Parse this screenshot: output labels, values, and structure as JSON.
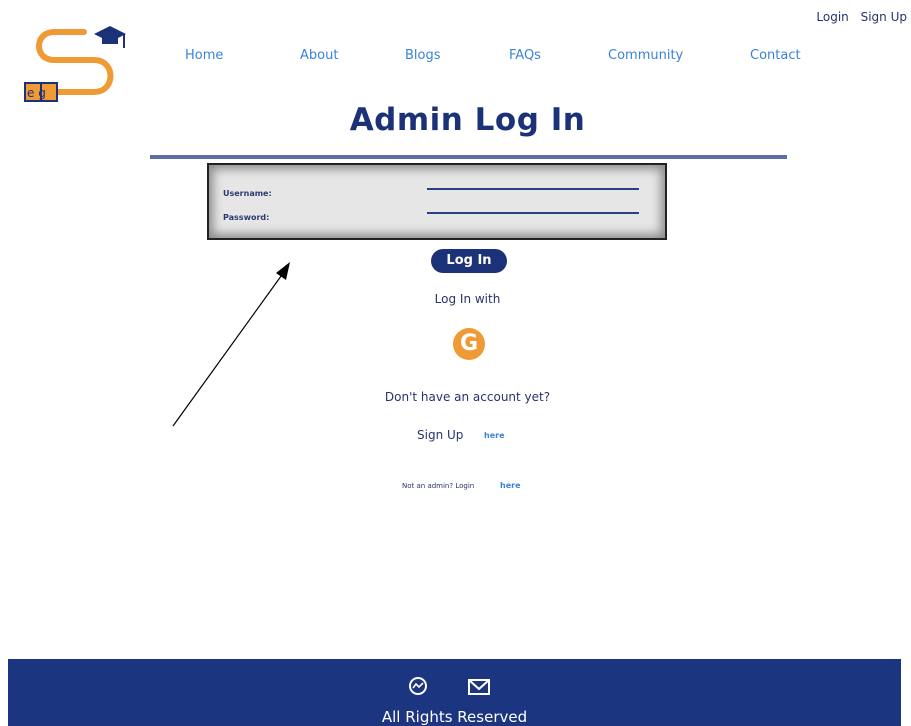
{
  "top": {
    "login": "Login",
    "signup": "Sign Up"
  },
  "logo": {
    "text": "e g"
  },
  "nav": {
    "items": [
      {
        "label": "Home"
      },
      {
        "label": "About"
      },
      {
        "label": "Blogs"
      },
      {
        "label": "FAQs"
      },
      {
        "label": "Community"
      },
      {
        "label": "Contact"
      }
    ]
  },
  "main": {
    "title": "Admin Log In",
    "username_label": "Username:",
    "password_label": "Password:",
    "login_button": "Log In",
    "login_with": "Log In with",
    "google_letter": "G",
    "no_account": "Don't have an account yet?",
    "signup_label": "Sign Up",
    "signup_link": "here",
    "not_admin": "Not an admin? Login",
    "not_admin_link": "here"
  },
  "footer": {
    "text": "All Rights Reserved",
    "icons": [
      "messenger-icon",
      "mail-icon"
    ]
  },
  "colors": {
    "navy": "#1c3278",
    "accent_orange": "#f09a36",
    "link_blue": "#3b83d8"
  }
}
